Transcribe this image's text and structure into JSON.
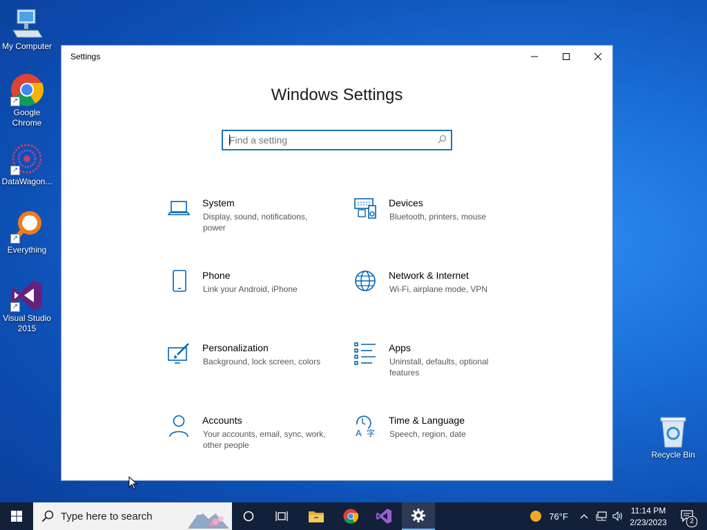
{
  "desktop": {
    "icons": [
      {
        "label": "My Computer"
      },
      {
        "label": "Google Chrome"
      },
      {
        "label": "DataWagon..."
      },
      {
        "label": "Everything"
      },
      {
        "label": "Visual Studio 2015"
      },
      {
        "label": "Recycle Bin"
      }
    ]
  },
  "window": {
    "title": "Settings",
    "heading": "Windows Settings",
    "search": {
      "placeholder": "Find a setting",
      "value": ""
    },
    "tiles": [
      {
        "title": "System",
        "desc": "Display, sound, notifications, power",
        "icon": "laptop-icon"
      },
      {
        "title": "Devices",
        "desc": "Bluetooth, printers, mouse",
        "icon": "devices-icon"
      },
      {
        "title": "Phone",
        "desc": "Link your Android, iPhone",
        "icon": "phone-icon"
      },
      {
        "title": "Network & Internet",
        "desc": "Wi-Fi, airplane mode, VPN",
        "icon": "globe-icon"
      },
      {
        "title": "Personalization",
        "desc": "Background, lock screen, colors",
        "icon": "paint-icon"
      },
      {
        "title": "Apps",
        "desc": "Uninstall, defaults, optional features",
        "icon": "apps-list-icon"
      },
      {
        "title": "Accounts",
        "desc": "Your accounts, email, sync, work, other people",
        "icon": "person-icon"
      },
      {
        "title": "Time & Language",
        "desc": "Speech, region, date",
        "icon": "time-language-icon"
      }
    ]
  },
  "taskbar": {
    "search_text": "Type here to search",
    "weather": "76°F",
    "time": "11:14 PM",
    "date": "2/23/2023",
    "notification_count": "2"
  },
  "colors": {
    "accent": "#0063b1",
    "taskbar": "#13203a"
  }
}
